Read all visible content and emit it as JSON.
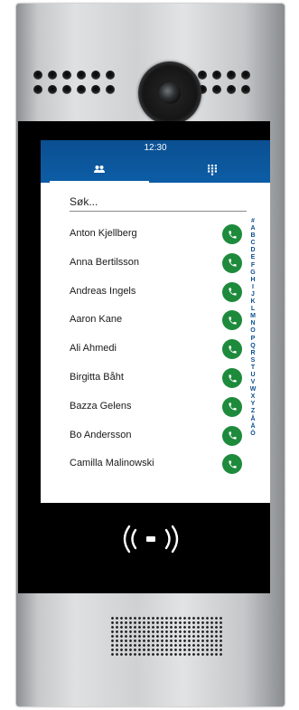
{
  "device": {
    "status_bar": {
      "time": "12:30"
    },
    "tabs": [
      {
        "id": "contacts",
        "icon": "contacts-icon",
        "active": true
      },
      {
        "id": "keypad",
        "icon": "dialpad-icon",
        "active": false
      }
    ],
    "search": {
      "placeholder": "Søk..."
    },
    "contacts": [
      {
        "name": "Anton Kjellberg"
      },
      {
        "name": "Anna Bertilsson"
      },
      {
        "name": "Andreas Ingels"
      },
      {
        "name": "Aaron Kane"
      },
      {
        "name": "Ali Ahmedi"
      },
      {
        "name": "Birgitta Båht"
      },
      {
        "name": "Bazza Gelens"
      },
      {
        "name": "Bo Andersson"
      },
      {
        "name": "Camilla Malinowski"
      }
    ],
    "alphabet_index": [
      "#",
      "A",
      "B",
      "C",
      "D",
      "E",
      "F",
      "G",
      "H",
      "I",
      "J",
      "K",
      "L",
      "M",
      "N",
      "O",
      "P",
      "Q",
      "R",
      "S",
      "T",
      "U",
      "V",
      "W",
      "X",
      "Y",
      "Z",
      "Å",
      "Ä",
      "Ö"
    ],
    "colors": {
      "header": "#0b4f91",
      "call_button": "#1e8a3c",
      "index_text": "#0b4f91"
    },
    "icons": {
      "camera": "camera-icon",
      "nfc": "nfc-reader-icon",
      "speaker": "speaker-grille",
      "call": "phone-icon"
    }
  }
}
